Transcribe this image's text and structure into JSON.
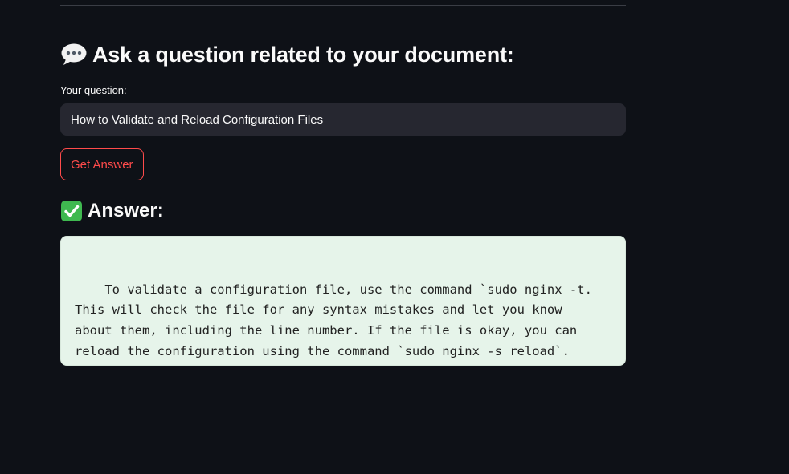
{
  "section": {
    "icon": "speech-balloon-icon",
    "title": "Ask a question related to your document:"
  },
  "question": {
    "label": "Your question:",
    "value": "How to Validate and Reload Configuration Files"
  },
  "button": {
    "label": "Get Answer"
  },
  "answer": {
    "icon": "check-mark-icon",
    "heading": "Answer:",
    "text": "\n    To validate a configuration file, use the command `sudo nginx -t.\nThis will check the file for any syntax mistakes and let you know\nabout them, including the line number. If the file is okay, you can\nreload the configuration using the command `sudo nginx -s reload`."
  },
  "colors": {
    "background": "#0e1117",
    "input_background": "#262730",
    "accent": "#ff4b4b",
    "answer_background": "#e6f4ea",
    "check_green": "#3fb950"
  }
}
